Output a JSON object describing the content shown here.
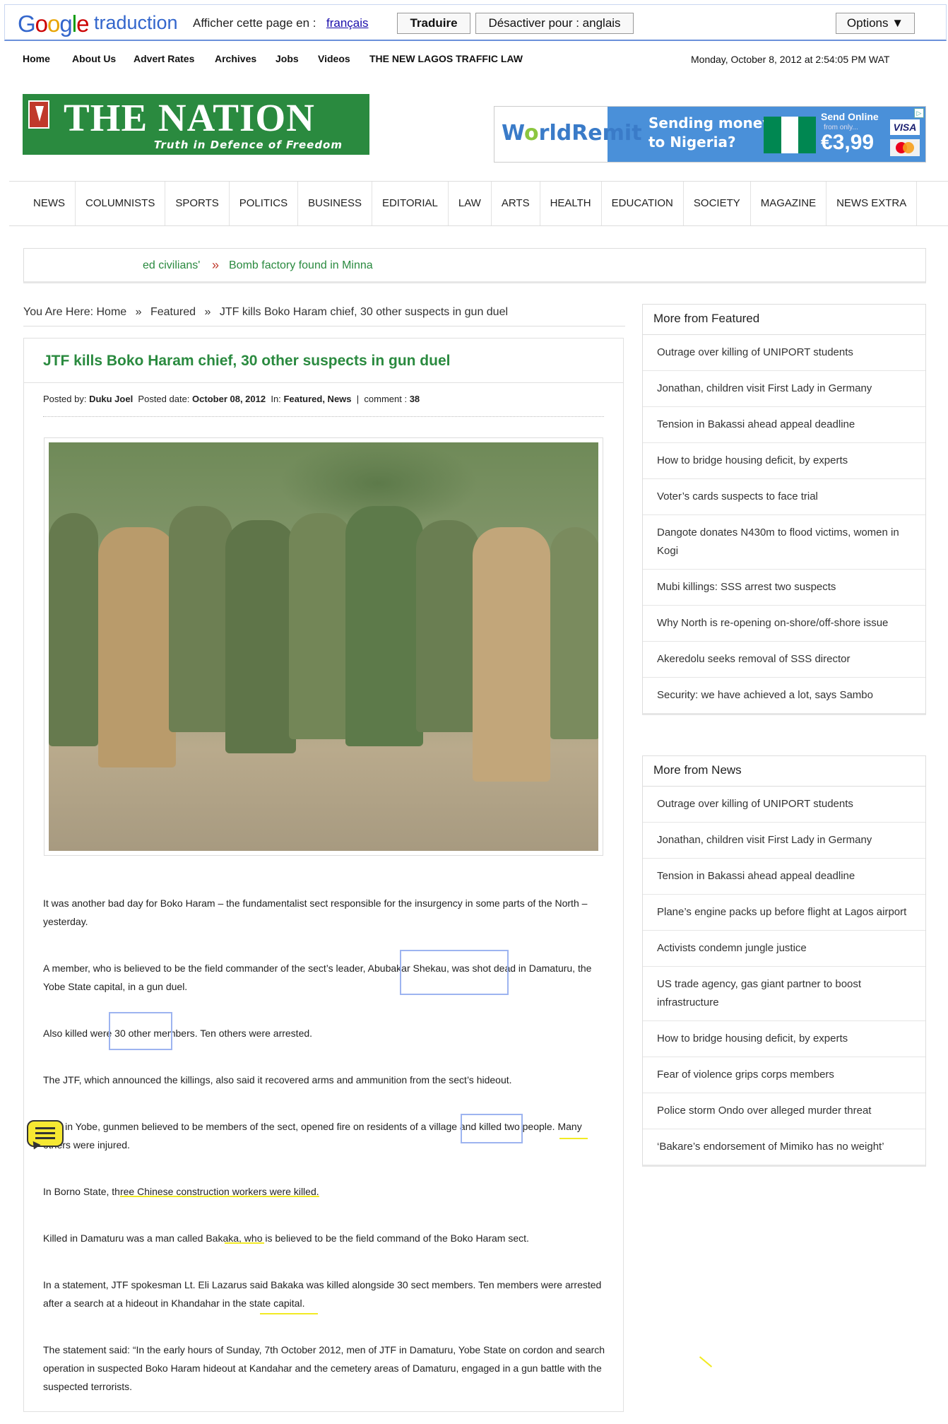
{
  "translate_bar": {
    "logo_text": "Google",
    "product": "traduction",
    "prompt": "Afficher cette page en :",
    "language": "français",
    "translate_button": "Traduire",
    "disable_button": "Désactiver pour : anglais",
    "options_button": "Options ▼"
  },
  "top_nav": [
    "Home",
    "About Us",
    "Advert Rates",
    "Archives",
    "Jobs",
    "Videos",
    "THE NEW LAGOS TRAFFIC LAW"
  ],
  "date_line": "Monday, October 8, 2012 at 2:54:05 PM WAT",
  "logo": {
    "title": "THE NATION",
    "tagline": "Truth in Defence of Freedom"
  },
  "ad": {
    "brand_a": "W",
    "brand_b": "rldRemit",
    "headline": "Sending money\nto Nigeria?",
    "send": "Send Online",
    "from": "from only...",
    "price": "€3,99",
    "visa": "VISA"
  },
  "main_nav": [
    "NEWS",
    "COLUMNISTS",
    "SPORTS",
    "POLITICS",
    "BUSINESS",
    "EDITORIAL",
    "LAW",
    "ARTS",
    "HEALTH",
    "EDUCATION",
    "SOCIETY",
    "MAGAZINE",
    "NEWS EXTRA"
  ],
  "ticker": {
    "item1": "ed civilians'",
    "separator": "»",
    "item2": "Bomb factory found in Minna"
  },
  "breadcrumb": {
    "prefix": "You Are Here:",
    "home": "Home",
    "sep": "»",
    "section": "Featured",
    "current": "JTF kills Boko Haram chief, 30 other suspects in gun duel"
  },
  "article": {
    "title": "JTF kills Boko Haram chief, 30 other suspects in gun duel",
    "meta": {
      "posted_by_label": "Posted by:",
      "author": "Duku Joel",
      "date_label": "Posted date:",
      "date": "October 08, 2012",
      "in_label": "In:",
      "categories": "Featured, News",
      "divider": "|",
      "comment_label": "comment :",
      "comment_count": "38"
    },
    "paragraphs": [
      "It was another bad day for Boko Haram – the fundamentalist sect responsible for the insurgency in some parts of the North – yesterday.",
      "A member, who is believed to be the field commander of the sect’s leader, Abubakar Shekau, was shot dead in Damaturu, the Yobe State capital, in a gun duel.",
      "Also killed were 30 other members. Ten others were arrested.",
      "The JTF, which announced the killings, also said it recovered arms and ammunition from the sect’s hideout.",
      "Also in Yobe, gunmen believed to be members of the sect, opened fire on residents of a village and killed two people. Many others were injured.",
      "In Borno State, three Chinese construction workers were killed.",
      "Killed in Damaturu was a man called Bakaka, who is believed to be the field command of the Boko Haram sect.",
      "In a statement, JTF spokesman Lt. Eli Lazarus said Bakaka was killed alongside 30 sect members. Ten members were arrested after a search at a hideout in Khandahar in the state capital.",
      "The statement said: “In the early hours of Sunday, 7th October 2012, men of JTF in Damaturu, Yobe State on cordon and search operation in suspected Boko Haram hideout at Kandahar and the cemetery areas of Damaturu, engaged in a gun battle with the suspected terrorists."
    ]
  },
  "sidebar_featured": {
    "title": "More from Featured",
    "items": [
      "Outrage over killing of UNIPORT students",
      "Jonathan, children visit First Lady in Germany",
      "Tension in Bakassi ahead appeal deadline",
      "How to bridge housing deficit, by experts",
      "Voter’s cards suspects to face trial",
      "Dangote donates N430m to flood victims, women in Kogi",
      "Mubi killings: SSS arrest two suspects",
      "Why North is re-opening on-shore/off-shore issue",
      "Akeredolu seeks removal of SSS director",
      "Security: we have achieved a lot, says Sambo"
    ]
  },
  "sidebar_news": {
    "title": "More from News",
    "items": [
      "Outrage over killing of UNIPORT students",
      "Jonathan, children visit First Lady in Germany",
      "Tension in Bakassi ahead appeal deadline",
      "Plane’s engine packs up before flight at Lagos airport",
      "Activists condemn jungle justice",
      "US trade agency, gas giant partner to boost infrastructure",
      "How to bridge housing deficit, by experts",
      "Fear of violence grips corps members",
      "Police storm Ondo over alleged murder threat",
      "‘Bakare’s endorsement of Mimiko has no weight’"
    ]
  },
  "colors": {
    "brand_green": "#2a8a3f",
    "highlight_yellow": "#f2ea24",
    "box_blue": "#9db4f0"
  }
}
